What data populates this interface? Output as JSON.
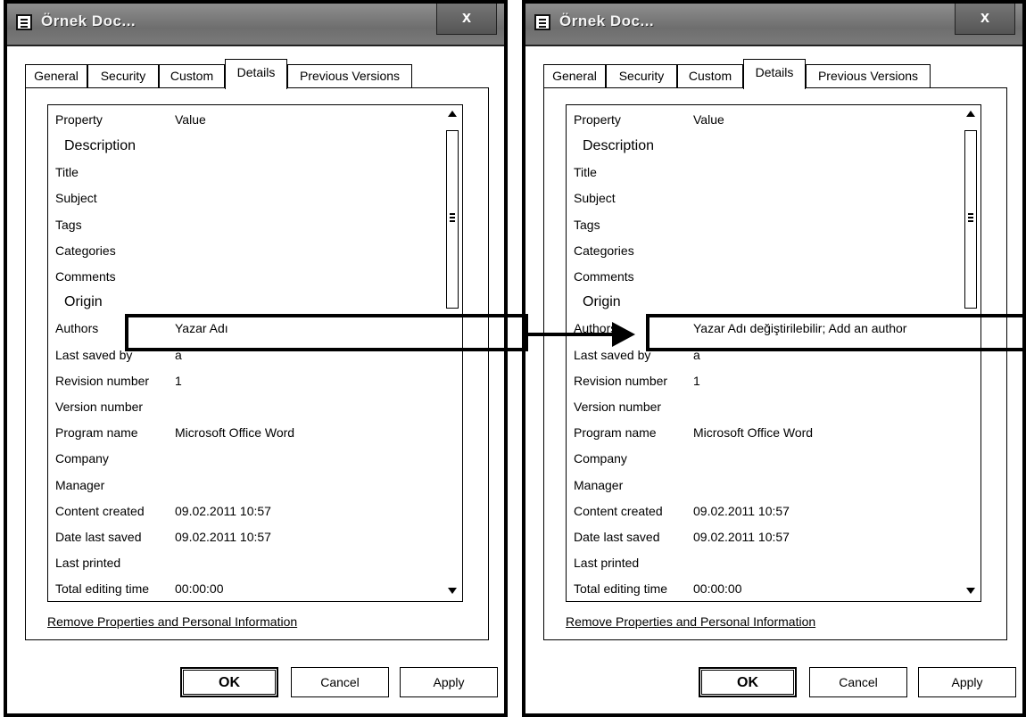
{
  "left_dialog": {
    "title": "Örnek Doc...",
    "close": "x",
    "tabs": [
      "General",
      "Security",
      "Custom",
      "Details",
      "Previous Versions"
    ],
    "active_tab": "Details",
    "header": {
      "property": "Property",
      "value": "Value"
    },
    "rows": [
      {
        "section": "Description"
      },
      {
        "k": "Title",
        "v": ""
      },
      {
        "k": "Subject",
        "v": ""
      },
      {
        "k": "Tags",
        "v": ""
      },
      {
        "k": "Categories",
        "v": ""
      },
      {
        "k": "Comments",
        "v": ""
      },
      {
        "section": "Origin"
      },
      {
        "k": "Authors",
        "v": "Yazar Adı"
      },
      {
        "k": "Last saved by",
        "v": "a"
      },
      {
        "k": "Revision number",
        "v": "1"
      },
      {
        "k": "Version number",
        "v": ""
      },
      {
        "k": "Program name",
        "v": "Microsoft Office Word"
      },
      {
        "k": "Company",
        "v": ""
      },
      {
        "k": "Manager",
        "v": ""
      },
      {
        "k": "Content created",
        "v": "09.02.2011 10:57"
      },
      {
        "k": "Date last saved",
        "v": "09.02.2011 10:57"
      },
      {
        "k": "Last printed",
        "v": ""
      },
      {
        "k": "Total editing time",
        "v": "00:00:00"
      }
    ],
    "remove_link": "Remove Properties and Personal Information",
    "buttons": {
      "ok": "OK",
      "cancel": "Cancel",
      "apply": "Apply"
    }
  },
  "right_dialog": {
    "title": "Örnek Doc...",
    "close": "x",
    "tabs": [
      "General",
      "Security",
      "Custom",
      "Details",
      "Previous Versions"
    ],
    "active_tab": "Details",
    "header": {
      "property": "Property",
      "value": "Value"
    },
    "rows": [
      {
        "section": "Description"
      },
      {
        "k": "Title",
        "v": ""
      },
      {
        "k": "Subject",
        "v": ""
      },
      {
        "k": "Tags",
        "v": ""
      },
      {
        "k": "Categories",
        "v": ""
      },
      {
        "k": "Comments",
        "v": ""
      },
      {
        "section": "Origin"
      },
      {
        "k": "Authors",
        "v": "Yazar Adı değiştirilebilir; Add an author"
      },
      {
        "k": "Last saved by",
        "v": "a"
      },
      {
        "k": "Revision number",
        "v": "1"
      },
      {
        "k": "Version number",
        "v": ""
      },
      {
        "k": "Program name",
        "v": "Microsoft Office Word"
      },
      {
        "k": "Company",
        "v": ""
      },
      {
        "k": "Manager",
        "v": ""
      },
      {
        "k": "Content created",
        "v": "09.02.2011 10:57"
      },
      {
        "k": "Date last saved",
        "v": "09.02.2011 10:57"
      },
      {
        "k": "Last printed",
        "v": ""
      },
      {
        "k": "Total editing time",
        "v": "00:00:00"
      }
    ],
    "remove_link": "Remove Properties and Personal Information",
    "buttons": {
      "ok": "OK",
      "cancel": "Cancel",
      "apply": "Apply"
    }
  },
  "icons": {
    "app": "document-icon",
    "scroll_up": "arrow-up-icon",
    "scroll_down": "arrow-down-icon",
    "annotation": "right-arrow-icon"
  }
}
